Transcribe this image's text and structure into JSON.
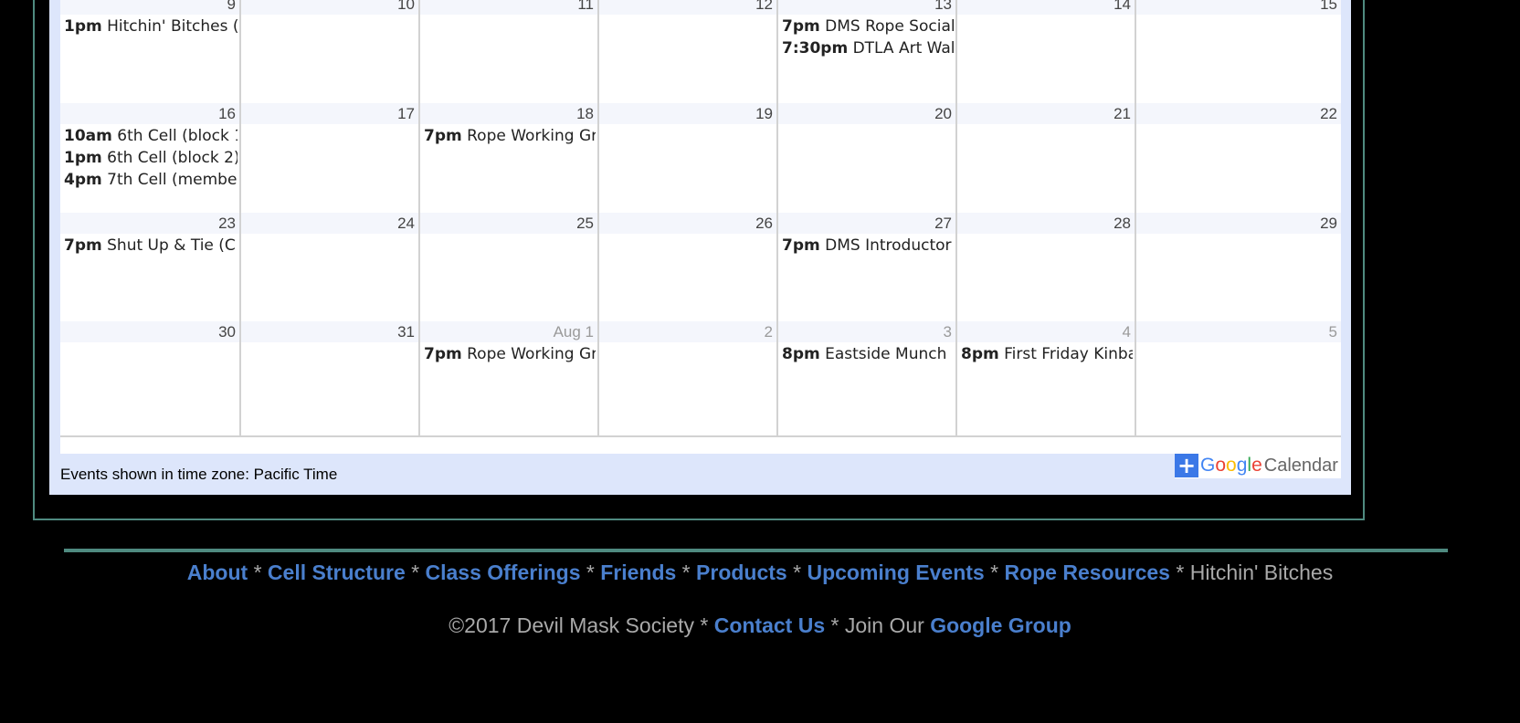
{
  "calendar": {
    "weeks": [
      {
        "days": [
          {
            "num": "9",
            "other": false,
            "events": [
              {
                "time": "1pm",
                "title": "Hitchin' Bitches ("
              }
            ]
          },
          {
            "num": "10",
            "other": false,
            "events": []
          },
          {
            "num": "11",
            "other": false,
            "events": []
          },
          {
            "num": "12",
            "other": false,
            "events": []
          },
          {
            "num": "13",
            "other": false,
            "events": [
              {
                "time": "7pm",
                "title": "DMS Rope Social"
              },
              {
                "time": "7:30pm",
                "title": "DTLA Art Walk"
              }
            ]
          },
          {
            "num": "14",
            "other": false,
            "events": []
          },
          {
            "num": "15",
            "other": false,
            "events": []
          }
        ]
      },
      {
        "days": [
          {
            "num": "16",
            "other": false,
            "events": [
              {
                "time": "10am",
                "title": "6th Cell (block 1"
              },
              {
                "time": "1pm",
                "title": "6th Cell (block 2)"
              },
              {
                "time": "4pm",
                "title": "7th Cell (membe"
              }
            ]
          },
          {
            "num": "17",
            "other": false,
            "events": []
          },
          {
            "num": "18",
            "other": false,
            "events": [
              {
                "time": "7pm",
                "title": "Rope Working Gr"
              }
            ]
          },
          {
            "num": "19",
            "other": false,
            "events": []
          },
          {
            "num": "20",
            "other": false,
            "events": []
          },
          {
            "num": "21",
            "other": false,
            "events": []
          },
          {
            "num": "22",
            "other": false,
            "events": []
          }
        ]
      },
      {
        "days": [
          {
            "num": "23",
            "other": false,
            "events": [
              {
                "time": "7pm",
                "title": "Shut Up & Tie (C"
              }
            ]
          },
          {
            "num": "24",
            "other": false,
            "events": []
          },
          {
            "num": "25",
            "other": false,
            "events": []
          },
          {
            "num": "26",
            "other": false,
            "events": []
          },
          {
            "num": "27",
            "other": false,
            "events": [
              {
                "time": "7pm",
                "title": "DMS Introductor"
              }
            ]
          },
          {
            "num": "28",
            "other": false,
            "events": []
          },
          {
            "num": "29",
            "other": false,
            "events": []
          }
        ]
      },
      {
        "days": [
          {
            "num": "30",
            "other": false,
            "events": []
          },
          {
            "num": "31",
            "other": false,
            "events": []
          },
          {
            "num": "Aug 1",
            "other": true,
            "events": [
              {
                "time": "7pm",
                "title": "Rope Working Gr"
              }
            ]
          },
          {
            "num": "2",
            "other": true,
            "events": []
          },
          {
            "num": "3",
            "other": true,
            "events": [
              {
                "time": "8pm",
                "title": "Eastside Munch"
              }
            ]
          },
          {
            "num": "4",
            "other": true,
            "events": [
              {
                "time": "8pm",
                "title": "First Friday Kinba"
              }
            ]
          },
          {
            "num": "5",
            "other": true,
            "events": []
          }
        ]
      }
    ],
    "timezone_note": "Events shown in time zone: Pacific Time",
    "google_button": {
      "plus": "+",
      "google_letters": [
        "G",
        "o",
        "o",
        "g",
        "l",
        "e"
      ],
      "google_colors": [
        "#4285f4",
        "#ea4335",
        "#fbbc05",
        "#4285f4",
        "#34a853",
        "#ea4335"
      ],
      "calendar_word": "Calendar"
    }
  },
  "footer": {
    "nav": [
      {
        "label": "About",
        "link": true
      },
      {
        "label": "Cell Structure",
        "link": true
      },
      {
        "label": "Class Offerings",
        "link": true
      },
      {
        "label": "Friends",
        "link": true
      },
      {
        "label": "Products",
        "link": true
      },
      {
        "label": "Upcoming Events",
        "link": true
      },
      {
        "label": "Rope Resources",
        "link": true
      },
      {
        "label": "Hitchin' Bitches",
        "link": false
      }
    ],
    "separator": " * ",
    "copyright": "©2017 Devil Mask Society",
    "contact_label": "Contact Us",
    "join_text": "Join Our",
    "group_label": "Google Group"
  },
  "colors": {
    "accent_teal": "#4f8a80",
    "link_blue": "#4a7fcd",
    "calendar_bg": "#dde6fb"
  }
}
